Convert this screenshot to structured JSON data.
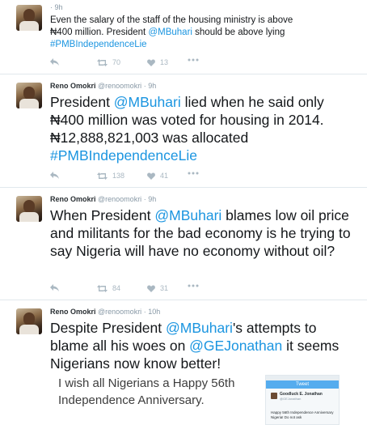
{
  "tweets": [
    {
      "name": "",
      "handle": "",
      "time": "· 9h",
      "text_pre": "Even the salary of the staff of the housing ministry is above ₦400 million. President ",
      "mention": "@MBuhari",
      "text_mid": " should be above lying ",
      "hashtag": "#PMBIndependenceLie",
      "text_post": "",
      "retweets": "70",
      "likes": "13"
    },
    {
      "name": "Reno Omokri",
      "handle": "@renoomokri",
      "time": "· 9h",
      "text_pre": "President ",
      "mention": "@MBuhari",
      "text_mid": " lied when he said only ₦400 million was voted for housing in 2014. ₦12,888,821,003  was allocated ",
      "hashtag": "#PMBIndependenceLie",
      "text_post": "",
      "retweets": "138",
      "likes": "41"
    },
    {
      "name": "Reno Omokri",
      "handle": "@renoomokri",
      "time": "· 9h",
      "text_pre": "When President ",
      "mention": "@MBuhari",
      "text_mid": " blames low oil price and militants for the bad economy is he trying to say Nigeria will have no economy without oil?",
      "hashtag": "",
      "text_post": "",
      "retweets": "84",
      "likes": "31"
    },
    {
      "name": "Reno Omokri",
      "handle": "@renoomokri",
      "time": "· 10h",
      "text_pre": "Despite President ",
      "mention": "@MBuhari",
      "text_mid": "'s attempts to blame all his woes on ",
      "mention2": "@GEJonathan",
      "text_post": " it seems Nigerians now know better!"
    }
  ],
  "inset": {
    "text_line1": "I wish all Nigerians a Happy 56th",
    "text_line2": "Independence Anniversary.",
    "phone_title": "Tweet",
    "phone_name": "Goodluck E. Jonathan",
    "phone_handle": "@GEJonathan",
    "phone_text": "Happy 56th Independence Anniversary Nigeria! Do not ask"
  },
  "icons": {
    "reply": "reply-icon",
    "retweet": "retweet-icon",
    "like": "heart-icon",
    "more": "more-icon"
  },
  "colors": {
    "link": "#1b95e0",
    "muted": "#8899a6",
    "action": "#aab8c2"
  }
}
